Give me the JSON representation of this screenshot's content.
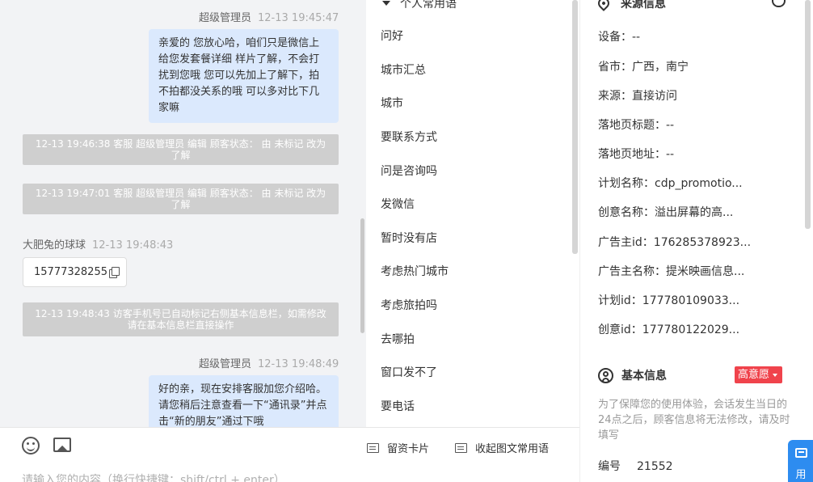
{
  "chat": {
    "messages": [
      {
        "sender": "超级管理员",
        "time": "12-13 19:45:47",
        "text": "亲爱的 您放心哈，咱们只是微信上给您发套餐详细 样片了解，不会打扰到您哦 您可以先加上了解下，拍不拍都没关系的哦 可以多对比下几家嘛"
      },
      {
        "system": "12-13 19:46:38 客服 超级管理员 编辑 顾客状态： 由 未标记 改为 了解"
      },
      {
        "system": "12-13 19:47:01 客服 超级管理员 编辑 顾客状态： 由 未标记 改为 了解"
      },
      {
        "sender": "大肥兔的球球",
        "time": "12-13 19:48:43",
        "phone": "15777328255"
      },
      {
        "system": "12-13 19:48:43 访客手机号已自动标记右侧基本信息栏，如需修改请在基本信息栏直接操作"
      },
      {
        "sender": "超级管理员",
        "time": "12-13 19:48:49",
        "text": "好的亲，现在安排客服加您介绍哈。请您稍后注意查看一下“通讯录”并点击“新的朋友”通过下哦"
      }
    ]
  },
  "phrases": {
    "header": "个人常用语",
    "items": [
      "问好",
      "城市汇总",
      "城市",
      "要联系方式",
      "问是咨询吗",
      "发微信",
      "暂时没有店",
      "考虑热门城市",
      "考虑旅拍吗",
      "去哪拍",
      "窗口发不了",
      "要电话"
    ]
  },
  "source_info": {
    "title": "来源信息",
    "rows": [
      {
        "label": "设备：",
        "value": "--"
      },
      {
        "label": "省市：",
        "value": "广西，南宁"
      },
      {
        "label": "来源：",
        "value": "直接访问"
      },
      {
        "label": "落地页标题：",
        "value": "--"
      },
      {
        "label": "落地页地址：",
        "value": "--"
      },
      {
        "label": "计划名称：",
        "value": "cdp_promotio..."
      },
      {
        "label": "创意名称：",
        "value": "溢出屏幕的高..."
      },
      {
        "label": "广告主id：",
        "value": "176285378923..."
      },
      {
        "label": "广告主名称：",
        "value": "提米映画信息..."
      },
      {
        "label": "计划id：",
        "value": "177780109033..."
      },
      {
        "label": "创意id：",
        "value": "177780122029..."
      }
    ]
  },
  "basic_info": {
    "title": "基本信息",
    "intent_tag": "高意愿",
    "note": "为了保障您的使用体验，会话发生当日的24点之后，顾客信息将无法修改，请及时填写",
    "number_label": "编号",
    "number_value": "21552"
  },
  "floating_button": {
    "label": "用"
  },
  "input_area": {
    "leave_card": "留资卡片",
    "collapse_phrases": "收起图文常用语",
    "placeholder": "请输入您的内容（换行快捷键：shift/ctrl + enter）"
  },
  "colors": {
    "accent": "#2d8cf0",
    "tag_red": "#f0434c",
    "bubble": "#dbe9fd",
    "system_msg": "#cfcfcf"
  }
}
